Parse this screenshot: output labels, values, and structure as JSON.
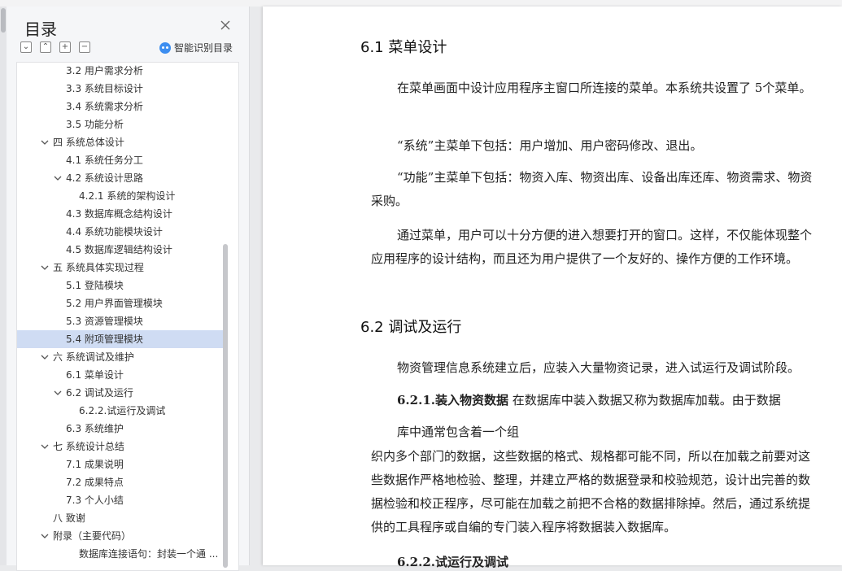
{
  "toc": {
    "title": "目录",
    "smart_label": "智能识别目录",
    "toolbar": [
      "⌄",
      "⌃",
      "+",
      "−"
    ],
    "items": [
      {
        "label": "3.2 用户需求分析",
        "level": 2,
        "chev": false
      },
      {
        "label": "3.3 系统目标设计",
        "level": 2,
        "chev": false
      },
      {
        "label": "3.4 系统需求分析",
        "level": 2,
        "chev": false
      },
      {
        "label": "3.5 功能分析",
        "level": 2,
        "chev": false
      },
      {
        "label": "四 系统总体设计",
        "level": 1,
        "chev": true
      },
      {
        "label": "4.1 系统任务分工",
        "level": 2,
        "chev": false
      },
      {
        "label": "4.2 系统设计思路",
        "level": 2,
        "chev": true
      },
      {
        "label": "4.2.1 系统的架构设计",
        "level": 3,
        "chev": false
      },
      {
        "label": "4.3 数据库概念结构设计",
        "level": 2,
        "chev": false
      },
      {
        "label": "4.4 系统功能模块设计",
        "level": 2,
        "chev": false
      },
      {
        "label": "4.5 数据库逻辑结构设计",
        "level": 2,
        "chev": false
      },
      {
        "label": "五 系统具体实现过程",
        "level": 1,
        "chev": true
      },
      {
        "label": "5.1 登陆模块",
        "level": 2,
        "chev": false
      },
      {
        "label": "5.2 用户界面管理模块",
        "level": 2,
        "chev": false
      },
      {
        "label": "5.3 资源管理模块",
        "level": 2,
        "chev": false
      },
      {
        "label": "5.4 附项管理模块",
        "level": 2,
        "chev": false,
        "active": true
      },
      {
        "label": "六 系统调试及维护",
        "level": 1,
        "chev": true
      },
      {
        "label": "6.1 菜单设计",
        "level": 2,
        "chev": false
      },
      {
        "label": "6.2 调试及运行",
        "level": 2,
        "chev": true
      },
      {
        "label": "6.2.2.试运行及调试",
        "level": 3,
        "chev": false
      },
      {
        "label": "6.3 系统维护",
        "level": 2,
        "chev": false
      },
      {
        "label": "七 系统设计总结",
        "level": 1,
        "chev": true
      },
      {
        "label": "7.1 成果说明",
        "level": 2,
        "chev": false
      },
      {
        "label": "7.2 成果特点",
        "level": 2,
        "chev": false
      },
      {
        "label": "7.3 个人小结",
        "level": 2,
        "chev": false
      },
      {
        "label": "八 致谢",
        "level": 1,
        "chev": false
      },
      {
        "label": "附录（主要代码）",
        "level": 1,
        "chev": true
      },
      {
        "label": "数据库连接语句：封装一个通 ...",
        "level": 3,
        "chev": false
      }
    ]
  },
  "doc": {
    "h_61": "6.1 菜单设计",
    "p1": "在菜单画面中设计应用程序主窗口所连接的菜单。本系统共设置了 5个菜单。",
    "p2": "“系统”主菜单下包括：用户增加、用户密码修改、退出。",
    "p3": "“功能”主菜单下包括：物资入库、物资出库、设备出库还库、物资需求、物资采购。",
    "p4": "通过菜单，用户可以十分方便的进入想要打开的窗口。这样，不仅能体现整个应用程序的设计结构，而且还为用户提供了一个友好的、操作方便的工作环境。",
    "h_62": "6.2 调试及运行",
    "p5": "物资管理信息系统建立后，应装入大量物资记录，进入试运行及调试阶段。",
    "p6_bold": "6.2.1.装入物资数据",
    "p6_rest": " 在数据库中装入数据又称为数据库加载。由于数据",
    "p6_line2": "库中通常包含着一个组",
    "p7": "织内多个部门的数据，这些数据的格式、规格都可能不同，所以在加载之前要对这些数据作严格地检验、整理，并建立严格的数据登录和校验规范，设计出完善的数据检验和校正程序，尽可能在加载之前把不合格的数据排除掉。然后，通过系统提供的工具程序或自编的专门装入程序将数据装入数据库。",
    "h_622": "6.2.2.试运行及调试"
  }
}
